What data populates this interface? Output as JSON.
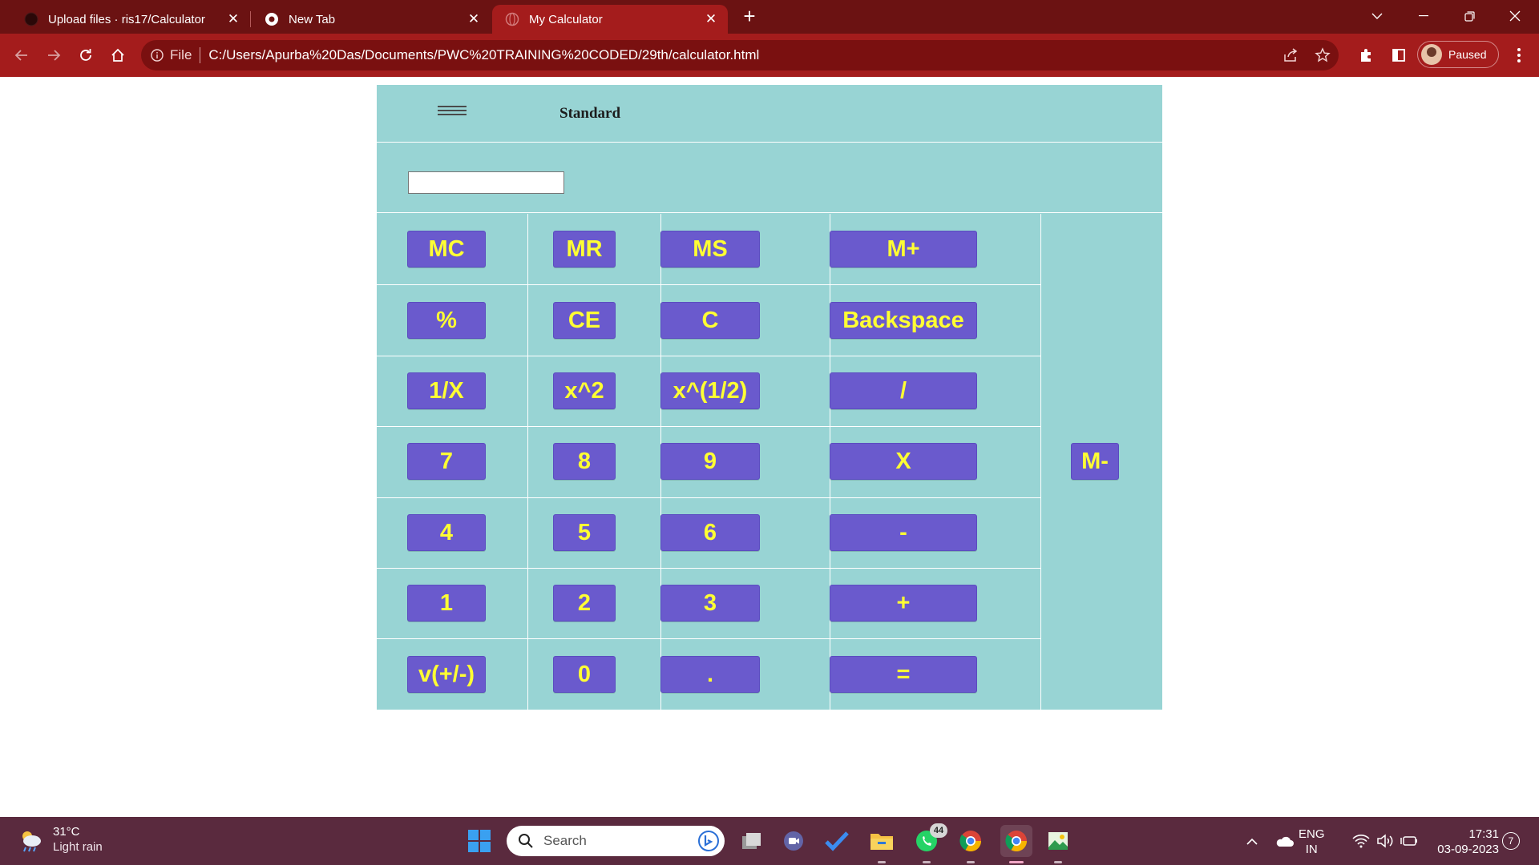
{
  "browser": {
    "tabs": [
      {
        "title": "Upload files · ris17/Calculator",
        "favicon": "github-icon"
      },
      {
        "title": "New Tab",
        "favicon": "chrome-icon"
      },
      {
        "title": "My Calculator",
        "favicon": "globe-icon"
      }
    ],
    "active_tab": 2,
    "address": {
      "scheme_label": "File",
      "url": "C:/Users/Apurba%20Das/Documents/PWC%20TRAINING%20CODED/29th/calculator.html"
    },
    "profile_label": "Paused",
    "colors": {
      "tabstrip": "#6b1212",
      "toolbar": "#a41c1c"
    }
  },
  "calculator": {
    "mode_title": "Standard",
    "display_value": "",
    "keys": [
      [
        "MC",
        "MR",
        "MS",
        "M+"
      ],
      [
        "%",
        "CE",
        "C",
        "Backspace"
      ],
      [
        "1/X",
        "x^2",
        "x^(1/2)",
        "/"
      ],
      [
        "7",
        "8",
        "9",
        "X"
      ],
      [
        "4",
        "5",
        "6",
        "-"
      ],
      [
        "1",
        "2",
        "3",
        "+"
      ],
      [
        "v(+/-)",
        "0",
        ".",
        "="
      ]
    ],
    "side_key": "M-",
    "colors": {
      "panel": "#98d4d4",
      "key_bg": "#6a5acd",
      "key_text": "#ffff33"
    }
  },
  "taskbar": {
    "weather": {
      "temp": "31°C",
      "condition": "Light rain"
    },
    "search_label": "Search",
    "whatsapp_badge": "44",
    "language": {
      "line1": "ENG",
      "line2": "IN"
    },
    "clock": {
      "time": "17:31",
      "date": "03-09-2023"
    },
    "notification_count": "7"
  }
}
